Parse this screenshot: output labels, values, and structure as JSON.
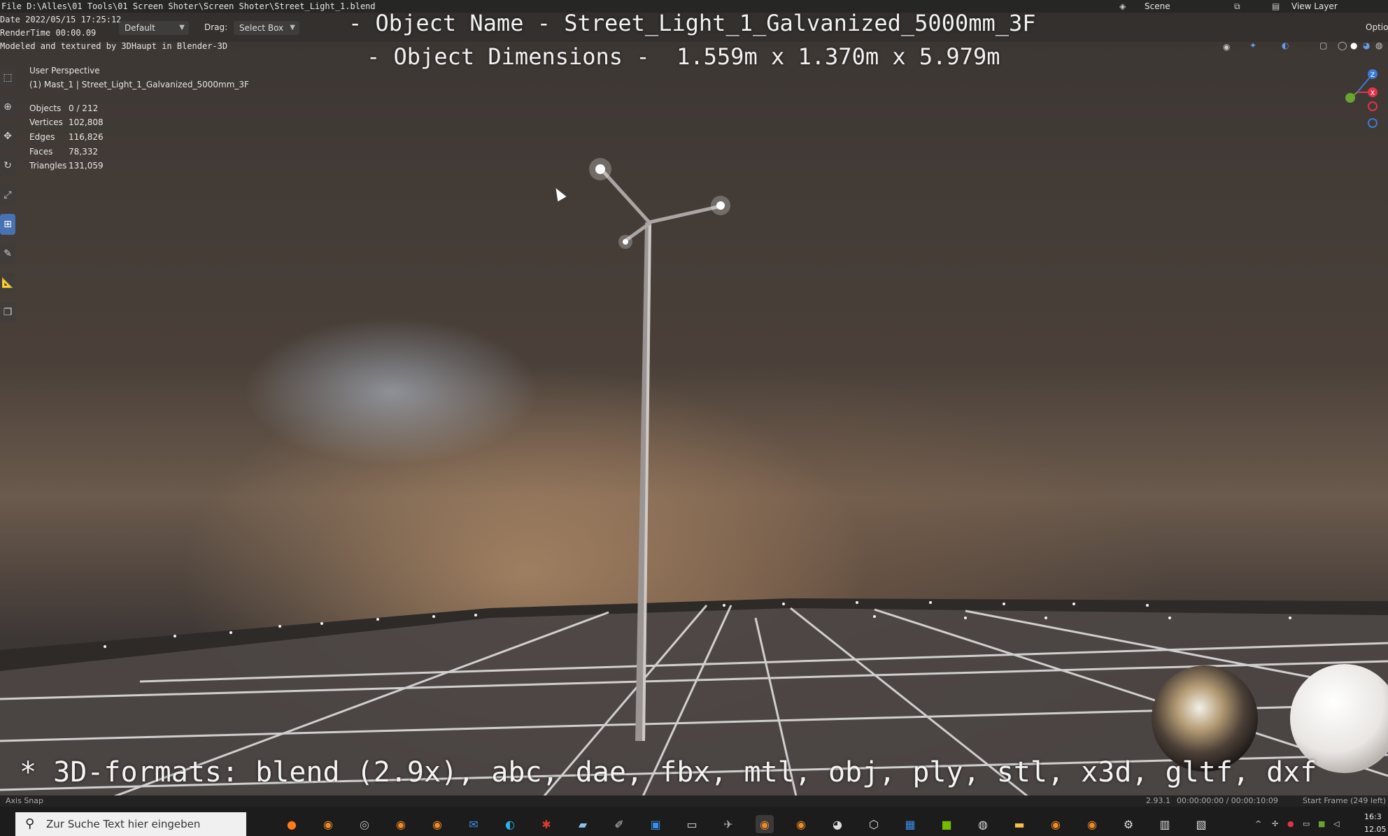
{
  "window": {
    "file_path": "File D:\\Alles\\01 Tools\\01 Screen Shoter\\Screen Shoter\\Street_Light_1.blend",
    "date_line": "Date 2022/05/15 17:25:12",
    "render_time": "RenderTime 00:00.09",
    "credit": "Modeled and textured by 3DHaupt in Blender-3D"
  },
  "header": {
    "orientation_label": "Default",
    "drag_label": "Drag:",
    "drag_value": "Select Box",
    "scene_label": "Scene",
    "view_layer_label": "View Layer",
    "options_label": "Option"
  },
  "overlay": {
    "object_name_line": "- Object Name - Street_Light_1_Galvanized_5000mm_3F",
    "dimensions_line": "- Object Dimensions -  1.559m x 1.370m x 5.979m",
    "formats_line": "* 3D-formats: blend (2.9x), abc, dae, fbx, mtl, obj, ply, stl, x3d, gltf, dxf"
  },
  "viewport_info": {
    "perspective": "User Perspective",
    "active_object": "(1) Mast_1 | Street_Light_1_Galvanized_5000mm_3F",
    "stats": [
      {
        "label": "Objects",
        "value": "0 / 212"
      },
      {
        "label": "Vertices",
        "value": "102,808"
      },
      {
        "label": "Edges",
        "value": "116,826"
      },
      {
        "label": "Faces",
        "value": "78,332"
      },
      {
        "label": "Triangles",
        "value": "131,059"
      }
    ]
  },
  "gizmo": {
    "z": "Z",
    "x": "X"
  },
  "statusbar": {
    "left": "Axis Snap",
    "version": "2.93.1",
    "timecode": "00:00:00:00 / 00:00:10:09",
    "start_frame": "Start Frame (249 left)"
  },
  "taskbar": {
    "search_placeholder": "Zur Suche Text hier eingeben",
    "clock": "16:3",
    "date": "12.05"
  },
  "colors": {
    "accent": "#4772b3",
    "gizmo_x": "#e0344a",
    "gizmo_y": "#6ba333",
    "gizmo_z": "#3d7ad6"
  }
}
